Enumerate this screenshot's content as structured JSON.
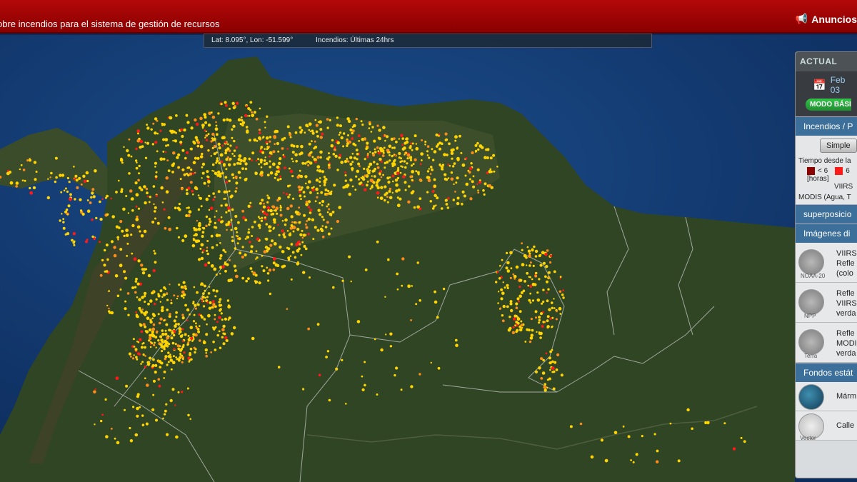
{
  "header": {
    "title": "obre incendios para el sistema de gestión de recursos",
    "announcements_label": "Anuncios"
  },
  "coordbar": {
    "latlon": "Lat: 8.095°, Lon: -51.599°",
    "fires": "Incendios: Últimas 24hrs"
  },
  "panel": {
    "header": "ACTUAL",
    "date": "Feb 03",
    "mode_button": "MODO BÁSICO",
    "fires_section": "Incendios / P",
    "simple_button": "Simple",
    "legend_title": "Tiempo desde la",
    "legend_lt6": "< 6",
    "legend_6": "6",
    "legend_hours": "[horas]",
    "legend_viirs": "VIIRS",
    "modis_line": "MODIS (Agua, T",
    "overlays_section": "superposicio",
    "imagery_section": "Imágenes di",
    "imagery_items": [
      {
        "thumb": "NOAA-20",
        "line1": "VIIRS",
        "line2": "Refle",
        "line3": "(colo"
      },
      {
        "thumb": "NPP",
        "line1": "Refle",
        "line2": "VIIRS",
        "line3": "verda"
      },
      {
        "thumb": "Terra",
        "line1": "Refle",
        "line2": "MODI",
        "line3": "verda"
      }
    ],
    "basemaps_section": "Fondos estát",
    "basemaps": [
      {
        "thumb": "",
        "label": "Márm"
      },
      {
        "thumb": "Vector",
        "label": "Calle"
      }
    ]
  },
  "colors": {
    "header_red": "#a30505",
    "fire_lt6": "#8b0000",
    "fire_6": "#ff1a1a",
    "fire_older": "#ffd400",
    "panel_section": "#3d6f9b"
  },
  "icons": {
    "announce": "megaphone-icon",
    "calendar": "calendar-icon"
  }
}
